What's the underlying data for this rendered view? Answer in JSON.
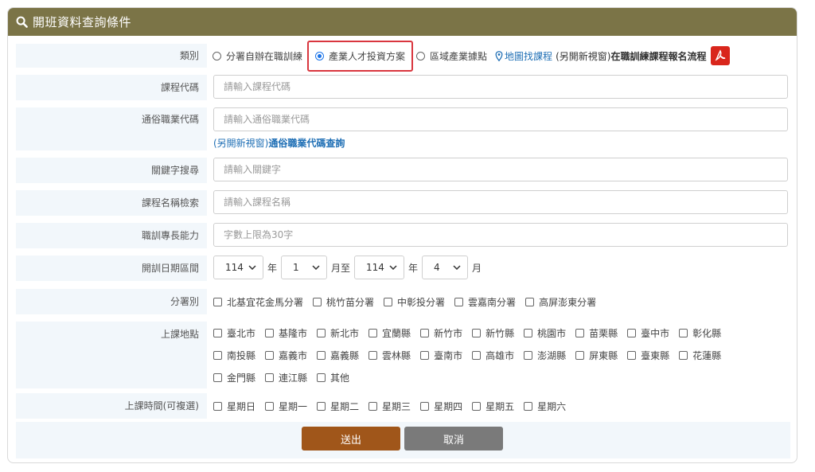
{
  "header": {
    "title": "開班資料查詢條件"
  },
  "category": {
    "label": "類別",
    "options": [
      "分署自辦在職訓練",
      "產業人才投資方案",
      "區域產業據點"
    ],
    "selected_index": 1,
    "map_link": "地圖找課程",
    "new_window_note": "(另開新視窗)",
    "flow_link": "在職訓練課程報名流程"
  },
  "course_code": {
    "label": "課程代碼",
    "placeholder": "請輸入課程代碼"
  },
  "occupation_code": {
    "label": "通俗職業代碼",
    "placeholder": "請輸入通俗職業代碼",
    "helper_note": "(另開新視窗)",
    "helper_link": "通俗職業代碼查詢"
  },
  "keyword": {
    "label": "關鍵字搜尋",
    "placeholder": "請輸入關鍵字"
  },
  "course_name": {
    "label": "課程名稱檢索",
    "placeholder": "請輸入課程名稱"
  },
  "skill": {
    "label": "職訓專長能力",
    "placeholder": "字數上限為30字"
  },
  "date_range": {
    "label": "開訓日期區間",
    "start_year": "114",
    "start_month": "1",
    "end_year": "114",
    "end_month": "4",
    "year_unit": "年",
    "month_to_unit": "月至",
    "month_unit": "月"
  },
  "branch": {
    "label": "分署別",
    "options": [
      "北基宜花金馬分署",
      "桃竹苗分署",
      "中彰投分署",
      "雲嘉南分署",
      "高屏澎東分署"
    ]
  },
  "location": {
    "label": "上課地點",
    "row1": [
      "臺北市",
      "基隆市",
      "新北市",
      "宜蘭縣",
      "新竹市",
      "新竹縣",
      "桃園市",
      "苗栗縣",
      "臺中市",
      "彰化縣"
    ],
    "row2": [
      "南投縣",
      "嘉義市",
      "嘉義縣",
      "雲林縣",
      "臺南市",
      "高雄市",
      "澎湖縣",
      "屏東縣",
      "臺東縣",
      "花蓮縣"
    ],
    "row3": [
      "金門縣",
      "連江縣",
      "其他"
    ]
  },
  "schedule": {
    "label": "上課時間(可複選)",
    "options": [
      "星期日",
      "星期一",
      "星期二",
      "星期三",
      "星期四",
      "星期五",
      "星期六"
    ]
  },
  "buttons": {
    "submit": "送出",
    "cancel": "取消"
  },
  "colors": {
    "header": "#7b7447",
    "submit": "#a0561a",
    "cancel": "#7a7a7a",
    "highlight": "#d9363e",
    "link": "#1f6fb5"
  }
}
